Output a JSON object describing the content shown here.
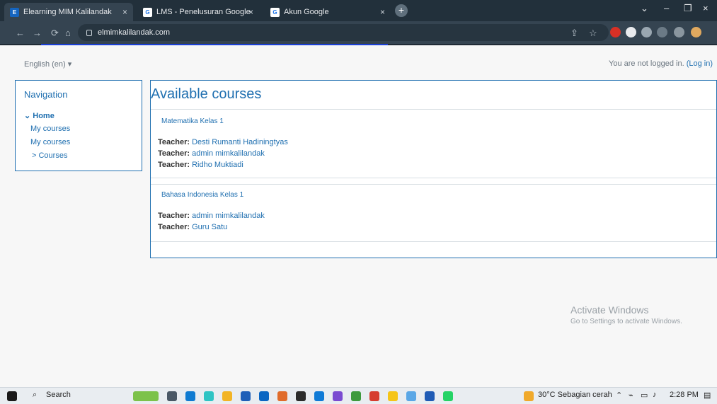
{
  "browser": {
    "tabs": [
      {
        "favicon": "moodle-icon",
        "title": "Elearning MIM Kalilandak"
      },
      {
        "favicon": "google-icon",
        "title": "LMS - Penelusuran Google"
      },
      {
        "favicon": "google-icon",
        "title": "Akun Google"
      }
    ],
    "address": "elmimkalilandak.com"
  },
  "header": {
    "language": "English (en) ▾",
    "login_text": "You are not logged in.",
    "login_link": "(Log in)"
  },
  "navigation": {
    "title": "Navigation",
    "home": "⌄ Home",
    "items": [
      "My courses",
      "My courses",
      "> Courses"
    ]
  },
  "main": {
    "title": "Available courses",
    "courses": [
      {
        "title": "Matematika Kelas 1",
        "teachers": [
          {
            "label": "Teacher:",
            "name": "Desti Rumanti Hadiningtyas"
          },
          {
            "label": "Teacher:",
            "name": "admin mimkalilandak"
          },
          {
            "label": "Teacher:",
            "name": "Ridho Muktiadi"
          }
        ]
      },
      {
        "title": "Bahasa Indonesia Kelas 1",
        "teachers": [
          {
            "label": "Teacher:",
            "name": "admin mimkalilandak"
          },
          {
            "label": "Teacher:",
            "name": "Guru Satu"
          }
        ]
      }
    ]
  },
  "watermark": {
    "line1": "Activate Windows",
    "line2": "Go to Settings to activate Windows."
  },
  "taskbar": {
    "search": "Search",
    "weather": "30°C  Sebagian cerah",
    "time": "2:28 PM"
  }
}
